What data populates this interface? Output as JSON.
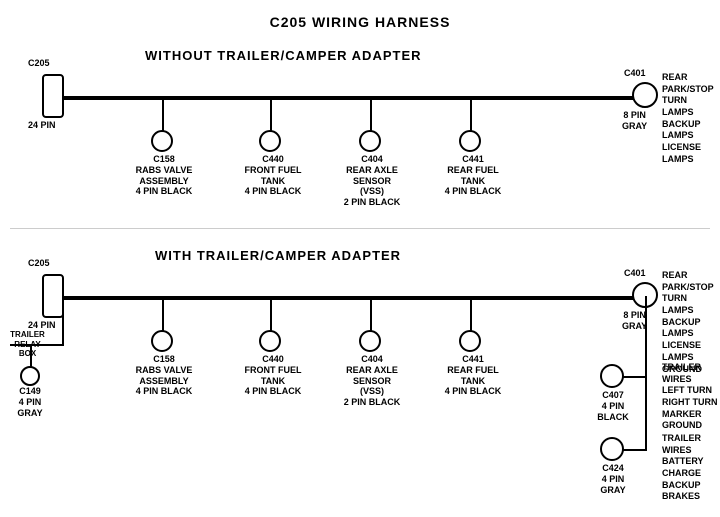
{
  "title": "C205 WIRING HARNESS",
  "section1": {
    "label": "WITHOUT  TRAILER/CAMPER  ADAPTER",
    "connectors": [
      {
        "id": "C205_top",
        "label": "C205",
        "sub": "24 PIN",
        "type": "rect"
      },
      {
        "id": "C158_top",
        "label": "C158",
        "sub": "RABS VALVE\nASSEMBLY\n4 PIN BLACK"
      },
      {
        "id": "C440_top",
        "label": "C440",
        "sub": "FRONT FUEL\nTANK\n4 PIN BLACK"
      },
      {
        "id": "C404_top",
        "label": "C404",
        "sub": "REAR AXLE\nSENSOR\n(VSS)\n2 PIN BLACK"
      },
      {
        "id": "C441_top",
        "label": "C441",
        "sub": "REAR FUEL\nTANK\n4 PIN BLACK"
      },
      {
        "id": "C401_top",
        "label": "C401",
        "sub": "8 PIN\nGRAY",
        "right_label": "REAR PARK/STOP\nTURN LAMPS\nBACKUP LAMPS\nLICENSE LAMPS"
      }
    ]
  },
  "section2": {
    "label": "WITH  TRAILER/CAMPER  ADAPTER",
    "connectors": [
      {
        "id": "C205_bot",
        "label": "C205",
        "sub": "24 PIN",
        "type": "rect"
      },
      {
        "id": "C149_bot",
        "label": "C149",
        "sub": "4 PIN GRAY"
      },
      {
        "id": "trailer_relay",
        "label": "TRAILER\nRELAY\nBOX"
      },
      {
        "id": "C158_bot",
        "label": "C158",
        "sub": "RABS VALVE\nASSEMBLY\n4 PIN BLACK"
      },
      {
        "id": "C440_bot",
        "label": "C440",
        "sub": "FRONT FUEL\nTANK\n4 PIN BLACK"
      },
      {
        "id": "C404_bot",
        "label": "C404",
        "sub": "REAR AXLE\nSENSOR\n(VSS)\n2 PIN BLACK"
      },
      {
        "id": "C441_bot",
        "label": "C441",
        "sub": "REAR FUEL\nTANK\n4 PIN BLACK"
      },
      {
        "id": "C401_bot",
        "label": "C401",
        "sub": "8 PIN\nGRAY",
        "right_label": "REAR PARK/STOP\nTURN LAMPS\nBACKUP LAMPS\nLICENSE LAMPS\nGROUND"
      },
      {
        "id": "C407_bot",
        "label": "C407",
        "sub": "4 PIN\nBLACK",
        "right_label": "TRAILER WIRES\nLEFT TURN\nRIGHT TURN\nMARKER\nGROUND"
      },
      {
        "id": "C424_bot",
        "label": "C424",
        "sub": "4 PIN\nGRAY",
        "right_label": "TRAILER WIRES\nBATTERY CHARGE\nBACKUP\nBRAKES"
      }
    ]
  }
}
